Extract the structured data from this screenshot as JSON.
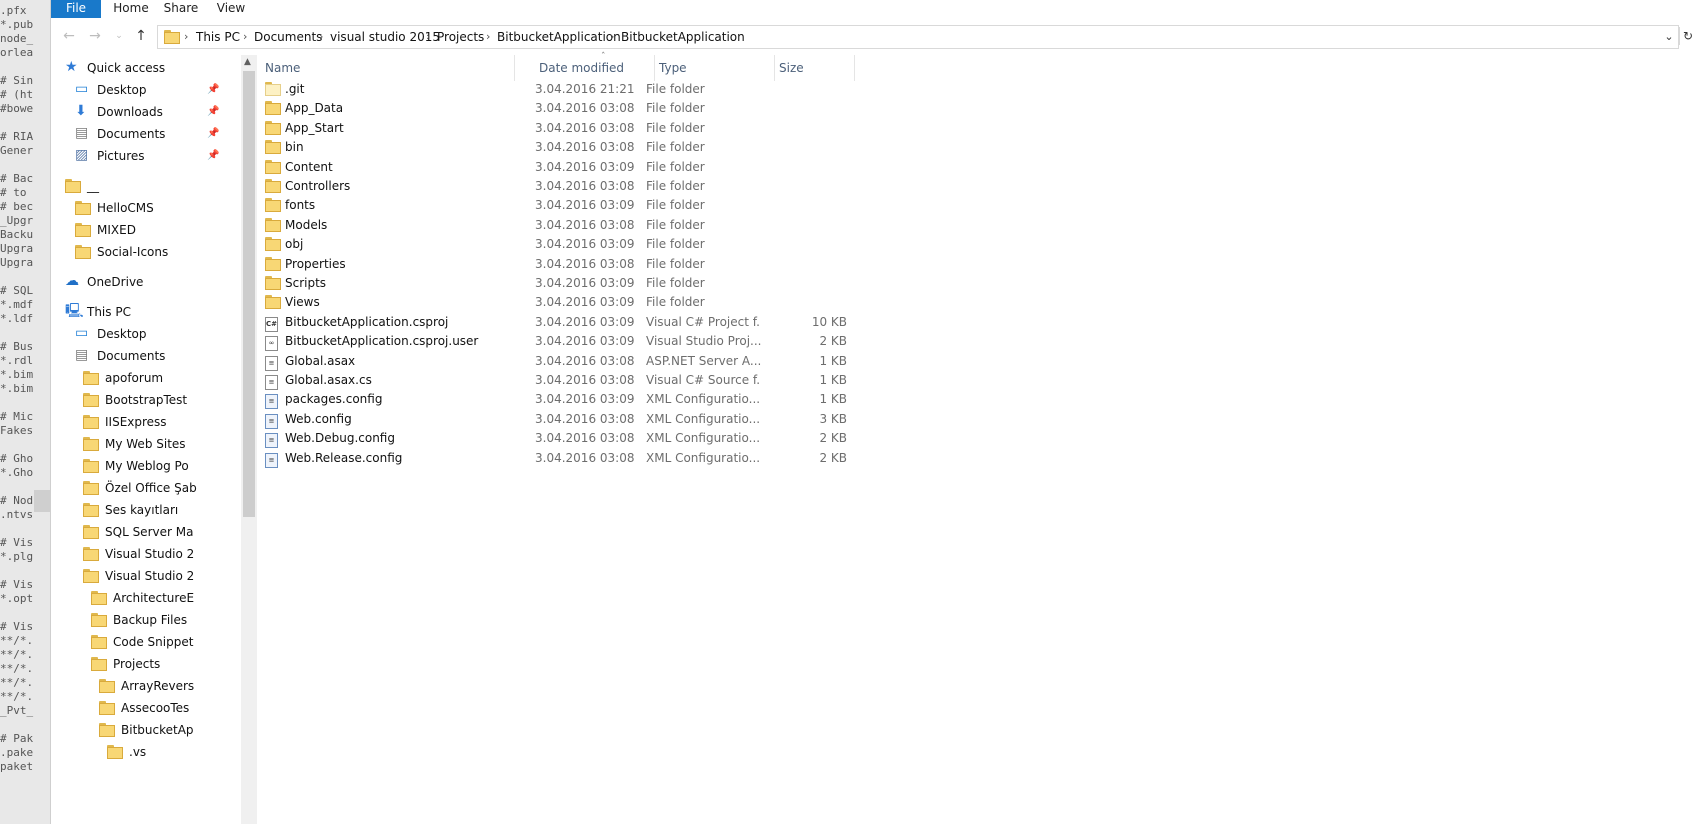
{
  "background_editor": {
    "lines": [
      ".pfx",
      "*.pub",
      "node_",
      "orlea",
      "",
      "# Sin",
      "# (ht",
      "#bowe",
      "",
      "# RIA",
      "Gener",
      "",
      "# Bac",
      "# to",
      "# bec",
      "_Upgr",
      "Backu",
      "Upgra",
      "Upgra",
      "",
      "# SQL",
      "*.mdf",
      "*.ldf",
      "",
      "# Bus",
      "*.rdl",
      "*.bim",
      "*.bim",
      "",
      "# Mic",
      "Fakes",
      "",
      "# Gho",
      "*.Gho",
      "",
      "# Nod",
      ".ntvs",
      "",
      "# Vis",
      "*.plg",
      "",
      "# Vis",
      "*.opt",
      "",
      "# Vis",
      "**/*.",
      "**/*.",
      "**/*.",
      "**/*.",
      "**/*.",
      "_Pvt_",
      "",
      "# Pak",
      ".pake",
      "paket"
    ]
  },
  "ribbon": {
    "tabs": [
      "File",
      "Home",
      "Share",
      "View"
    ]
  },
  "address_bar": {
    "crumbs": [
      "This PC",
      "Documents",
      "visual studio 2015",
      "Projects",
      "BitbucketApplication",
      "BitbucketApplication"
    ]
  },
  "nav_pane": {
    "items": [
      {
        "label": "Quick access",
        "icon": "star-icon"
      },
      {
        "label": "Desktop",
        "icon": "desktop-icon",
        "pinned": true
      },
      {
        "label": "Downloads",
        "icon": "download-icon",
        "pinned": true
      },
      {
        "label": "Documents",
        "icon": "documents-icon",
        "pinned": true
      },
      {
        "label": "Pictures",
        "icon": "pictures-icon",
        "pinned": true
      },
      {
        "label": "__",
        "icon": "folder-icon"
      },
      {
        "label": "HelloCMS",
        "icon": "folder-icon"
      },
      {
        "label": "MIXED",
        "icon": "folder-icon"
      },
      {
        "label": "Social-Icons",
        "icon": "folder-icon"
      },
      {
        "label": "OneDrive",
        "icon": "cloud-icon"
      },
      {
        "label": "This PC",
        "icon": "computer-icon"
      },
      {
        "label": "Desktop",
        "icon": "desktop-icon"
      },
      {
        "label": "Documents",
        "icon": "documents-icon"
      },
      {
        "label": "apoforum",
        "icon": "folder-icon"
      },
      {
        "label": "BootstrapTest",
        "icon": "folder-icon"
      },
      {
        "label": "IISExpress",
        "icon": "folder-icon"
      },
      {
        "label": "My Web Sites",
        "icon": "folder-icon"
      },
      {
        "label": "My Weblog Po",
        "icon": "folder-icon"
      },
      {
        "label": "Özel Office Şab",
        "icon": "folder-icon"
      },
      {
        "label": "Ses kayıtları",
        "icon": "folder-icon"
      },
      {
        "label": "SQL Server Ma",
        "icon": "folder-icon"
      },
      {
        "label": "Visual Studio 2",
        "icon": "folder-icon"
      },
      {
        "label": "Visual Studio 2",
        "icon": "folder-icon"
      },
      {
        "label": "ArchitectureE",
        "icon": "folder-icon"
      },
      {
        "label": "Backup Files",
        "icon": "folder-icon"
      },
      {
        "label": "Code Snippet",
        "icon": "folder-icon"
      },
      {
        "label": "Projects",
        "icon": "folder-icon"
      },
      {
        "label": "ArrayRevers",
        "icon": "folder-icon"
      },
      {
        "label": "AssecooTes",
        "icon": "folder-icon"
      },
      {
        "label": "BitbucketAp",
        "icon": "folder-icon"
      },
      {
        "label": ".vs",
        "icon": "folder-icon"
      }
    ]
  },
  "columns": {
    "name": "Name",
    "date": "Date modified",
    "type": "Type",
    "size": "Size"
  },
  "files": [
    {
      "name": ".git",
      "date": "3.04.2016 21:21",
      "type": "File folder",
      "size": "",
      "icon": "folder-icon",
      "pale": true
    },
    {
      "name": "App_Data",
      "date": "3.04.2016 03:08",
      "type": "File folder",
      "size": "",
      "icon": "folder-icon"
    },
    {
      "name": "App_Start",
      "date": "3.04.2016 03:08",
      "type": "File folder",
      "size": "",
      "icon": "folder-icon"
    },
    {
      "name": "bin",
      "date": "3.04.2016 03:08",
      "type": "File folder",
      "size": "",
      "icon": "folder-icon"
    },
    {
      "name": "Content",
      "date": "3.04.2016 03:09",
      "type": "File folder",
      "size": "",
      "icon": "folder-icon"
    },
    {
      "name": "Controllers",
      "date": "3.04.2016 03:08",
      "type": "File folder",
      "size": "",
      "icon": "folder-icon"
    },
    {
      "name": "fonts",
      "date": "3.04.2016 03:09",
      "type": "File folder",
      "size": "",
      "icon": "folder-icon"
    },
    {
      "name": "Models",
      "date": "3.04.2016 03:08",
      "type": "File folder",
      "size": "",
      "icon": "folder-icon"
    },
    {
      "name": "obj",
      "date": "3.04.2016 03:09",
      "type": "File folder",
      "size": "",
      "icon": "folder-icon"
    },
    {
      "name": "Properties",
      "date": "3.04.2016 03:08",
      "type": "File folder",
      "size": "",
      "icon": "folder-icon"
    },
    {
      "name": "Scripts",
      "date": "3.04.2016 03:09",
      "type": "File folder",
      "size": "",
      "icon": "folder-icon"
    },
    {
      "name": "Views",
      "date": "3.04.2016 03:09",
      "type": "File folder",
      "size": "",
      "icon": "folder-icon"
    },
    {
      "name": "BitbucketApplication.csproj",
      "date": "3.04.2016 03:09",
      "type": "Visual C# Project f...",
      "size": "10 KB",
      "icon": "csproj-icon"
    },
    {
      "name": "BitbucketApplication.csproj.user",
      "date": "3.04.2016 03:09",
      "type": "Visual Studio Proj...",
      "size": "2 KB",
      "icon": "vs-file-icon"
    },
    {
      "name": "Global.asax",
      "date": "3.04.2016 03:08",
      "type": "ASP.NET Server A...",
      "size": "1 KB",
      "icon": "asax-file-icon"
    },
    {
      "name": "Global.asax.cs",
      "date": "3.04.2016 03:08",
      "type": "Visual C# Source f...",
      "size": "1 KB",
      "icon": "text-file-icon"
    },
    {
      "name": "packages.config",
      "date": "3.04.2016 03:09",
      "type": "XML Configuratio...",
      "size": "1 KB",
      "icon": "config-file-icon"
    },
    {
      "name": "Web.config",
      "date": "3.04.2016 03:08",
      "type": "XML Configuratio...",
      "size": "3 KB",
      "icon": "config-file-icon"
    },
    {
      "name": "Web.Debug.config",
      "date": "3.04.2016 03:08",
      "type": "XML Configuratio...",
      "size": "2 KB",
      "icon": "config-file-icon"
    },
    {
      "name": "Web.Release.config",
      "date": "3.04.2016 03:08",
      "type": "XML Configuratio...",
      "size": "2 KB",
      "icon": "config-file-icon"
    }
  ]
}
